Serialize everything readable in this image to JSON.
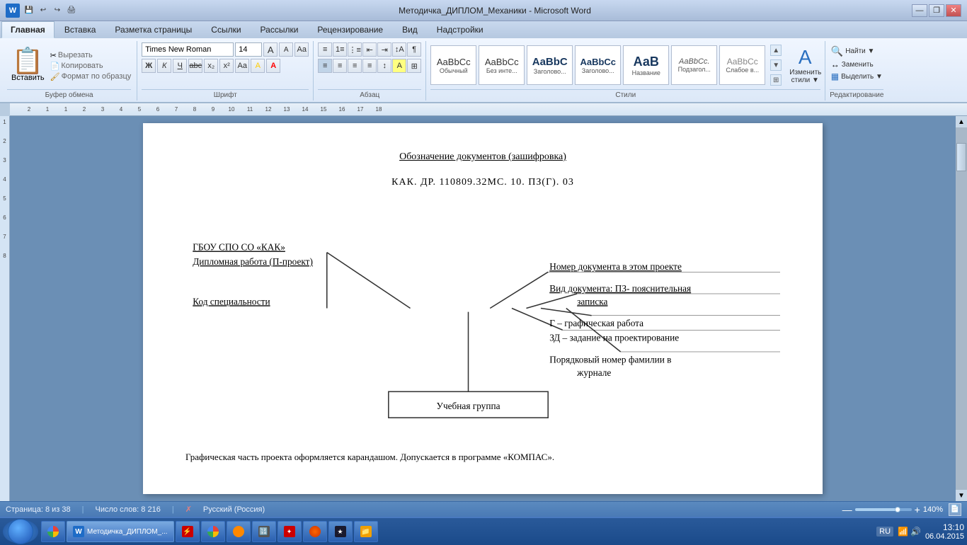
{
  "titlebar": {
    "title": "Методичка_ДИПЛОМ_Механики - Microsoft Word",
    "minimize": "—",
    "restore": "❐",
    "close": "✕"
  },
  "ribbon": {
    "tabs": [
      "Главная",
      "Вставка",
      "Разметка страницы",
      "Ссылки",
      "Рассылки",
      "Рецензирование",
      "Вид",
      "Надстройки"
    ],
    "active_tab": "Главная",
    "font_name": "Times New Roman",
    "font_size": "14",
    "groups": {
      "clipboard": "Буфер обмена",
      "font": "Шрифт",
      "paragraph": "Абзац",
      "styles": "Стили",
      "editing": "Редактирование"
    },
    "clipboard_buttons": [
      "Вставить",
      "Вырезать",
      "Копировать",
      "Формат по образцу"
    ],
    "styles": [
      {
        "name": "Обычный",
        "label": "AaBbCc"
      },
      {
        "name": "Без инте...",
        "label": "AaBbCc"
      },
      {
        "name": "Заголово...",
        "label": "AaBbC"
      },
      {
        "name": "Заголово...",
        "label": "AaBbCc"
      },
      {
        "name": "Название",
        "label": "АаВ"
      },
      {
        "name": "Подзагол...",
        "label": "AaBbCc."
      },
      {
        "name": "Слабое в...",
        "label": "AaBbCc"
      }
    ],
    "editing": {
      "find": "Найти",
      "replace": "Заменить",
      "select": "Выделить"
    }
  },
  "document": {
    "title": "Обозначение документов (зашифровка)",
    "code": "КАК. ДР. 110809.32МС. 10. ПЗ(Г). 03",
    "labels": {
      "left1": "ГБОУ СПО СО «КАК»",
      "left2": "Дипломная работа (П-проект)",
      "left3": "Код специальности",
      "right1": "Номер документа в этом проекте",
      "right2": "Вид документа: ПЗ- пояснительная записка",
      "right3": "Г – графическая работа",
      "right4": "ЗД – задание на проектирование",
      "right5": "Порядковый номер фамилии в журнале"
    },
    "uchebnaya": "Учебная группа",
    "bottom_text": "Графическая часть проекта оформляется карандашом. Допускается в программе «КОМПАС»."
  },
  "statusbar": {
    "page_info": "Страница: 8 из 38",
    "word_count": "Число слов: 8 216",
    "language": "Русский (Россия)",
    "zoom": "140%"
  },
  "taskbar": {
    "items": [
      {
        "label": ""
      },
      {
        "label": ""
      },
      {
        "label": ""
      },
      {
        "label": ""
      },
      {
        "label": ""
      },
      {
        "label": ""
      },
      {
        "label": ""
      },
      {
        "label": ""
      },
      {
        "label": ""
      },
      {
        "label": ""
      }
    ],
    "time": "13:10",
    "date": "06.04.2015",
    "lang": "RU"
  }
}
